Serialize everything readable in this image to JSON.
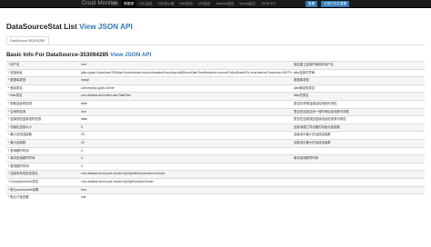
{
  "navbar": {
    "brand": "Druid Monitor",
    "items": [
      "首页",
      "数据源",
      "SQL监控",
      "SQL防火墙",
      "Web应用",
      "URI监控",
      "Session监控",
      "Spring监控",
      "JSON API"
    ],
    "active_index": 1,
    "reset_label": "重置",
    "log_reset_label": "记录日志并重置"
  },
  "header": {
    "title": "DataSourceStat List",
    "title_link": "View JSON API",
    "tab": "DataSource-353094285"
  },
  "basic_info": {
    "title": "Basic Info For DataSource-353094285",
    "title_link": "View JSON API",
    "rows": [
      {
        "name": "* 用户名",
        "value": "root",
        "desc": "指定建立连接时使用的用户名"
      },
      {
        "name": "* 连接地址",
        "value": "jdbc:mysql://localhost:3306/pet?useUnicode=true&characterEncoding=utf8&zeroDateTimeBehavior=convertToNull&useSSL=true&serverTimezone=GMT%2B8",
        "desc": "jdbc连接字符串"
      },
      {
        "name": "* 数据库类型",
        "value": "mysql",
        "desc": "数据库类型"
      },
      {
        "name": "* 驱动类名",
        "value": "com.mysql.cj.jdbc.Driver",
        "desc": "jdbc驱动的类名"
      },
      {
        "name": "* filter类名",
        "value": "com.alibaba.druid.filter.stat.StatFilter",
        "desc": "filter的类名"
      },
      {
        "name": "* 获取连接时检测",
        "value": "false",
        "desc": "是否在获得连接后检测其可用性"
      },
      {
        "name": "* 空闲时检测",
        "value": "true",
        "desc": "是否在连接空闲一段时间后检测其可用性"
      },
      {
        "name": "* 连接放回连接池时检测",
        "value": "false",
        "desc": "是否在连接放回连接池后检测其可用性"
      },
      {
        "name": "* 初始化连接大小",
        "value": "5",
        "desc": "连接池建立时创建的初始化连接数"
      },
      {
        "name": "* 最小空闲连接数",
        "value": "20",
        "desc": "连接池中最小的活跃连接数"
      },
      {
        "name": "* 最大连接数",
        "value": "20",
        "desc": "连接池中最大的活跃连接数"
      },
      {
        "name": "* 查询超时时间",
        "value": "0",
        "desc": ""
      },
      {
        "name": "* 事务查询超时时间",
        "value": "0",
        "desc": "事务查询超时时间"
      },
      {
        "name": "* 登录超时时间",
        "value": "0",
        "desc": ""
      },
      {
        "name": "* 连接有效性检查类名",
        "value": "com.alibaba.druid.pool.vendor.MySqlValidConnectionChecker",
        "desc": ""
      },
      {
        "name": "* ExceptionSorter类名",
        "value": "com.alibaba.druid.pool.vendor.MySqlExceptionSorter",
        "desc": ""
      },
      {
        "name": "* 默认autocommit设置",
        "value": "true",
        "desc": ""
      },
      {
        "name": "* 默认只读设置",
        "value": "null",
        "desc": ""
      }
    ]
  }
}
